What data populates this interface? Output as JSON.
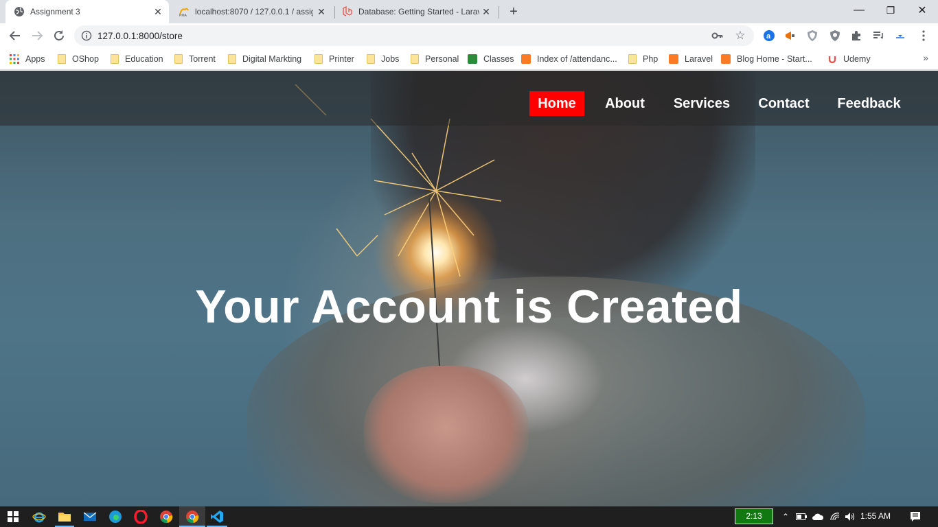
{
  "browser": {
    "tabs": [
      {
        "title": "Assignment 3",
        "active": true
      },
      {
        "title": "localhost:8070 / 127.0.0.1 / assig",
        "active": false
      },
      {
        "title": "Database: Getting Started - Larav",
        "active": false
      }
    ],
    "new_tab_label": "+",
    "window_controls": {
      "minimize": "—",
      "maximize": "❐",
      "close": "✕"
    },
    "url": "127.0.0.1:8000/store"
  },
  "bookmarks": [
    {
      "label": "Apps",
      "icon": "apps-grid-icon"
    },
    {
      "label": "OShop",
      "icon": "folder-icon"
    },
    {
      "label": "Education",
      "icon": "folder-icon"
    },
    {
      "label": "Torrent",
      "icon": "folder-icon"
    },
    {
      "label": "Digital Markting",
      "icon": "folder-icon"
    },
    {
      "label": "Printer",
      "icon": "folder-icon"
    },
    {
      "label": "Jobs",
      "icon": "folder-icon"
    },
    {
      "label": "Personal",
      "icon": "folder-icon"
    },
    {
      "label": "Classes",
      "icon": "classroom-icon"
    },
    {
      "label": "Index of /attendanc...",
      "icon": "xampp-icon"
    },
    {
      "label": "Php",
      "icon": "folder-icon"
    },
    {
      "label": "Laravel",
      "icon": "xampp-icon"
    },
    {
      "label": "Blog Home - Start...",
      "icon": "xampp-icon"
    },
    {
      "label": "Udemy",
      "icon": "udemy-icon"
    }
  ],
  "bookmarks_overflow": "»",
  "site": {
    "nav": [
      {
        "label": "Home",
        "active": true
      },
      {
        "label": "About",
        "active": false
      },
      {
        "label": "Services",
        "active": false
      },
      {
        "label": "Contact",
        "active": false
      },
      {
        "label": "Feedback",
        "active": false
      }
    ],
    "hero_title": "Your Account is Created",
    "accent_color": "#ff0000"
  },
  "taskbar": {
    "timer": "2:13",
    "time": "1:55 AM"
  }
}
